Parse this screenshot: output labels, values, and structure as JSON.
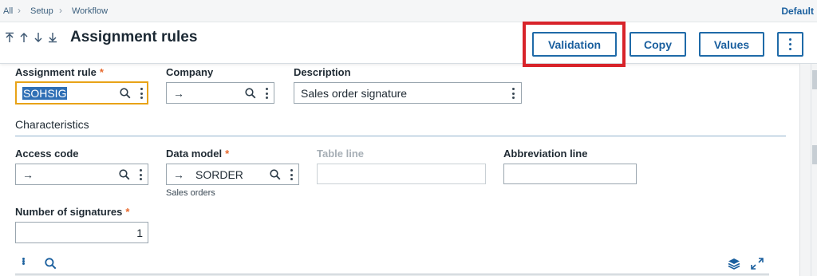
{
  "breadcrumb": {
    "items": [
      "All",
      "Setup",
      "Workflow"
    ],
    "default_link": "Default"
  },
  "header": {
    "title": "Assignment rules",
    "actions": {
      "validation": "Validation",
      "copy": "Copy",
      "values": "Values"
    }
  },
  "form": {
    "assignment_rule": {
      "label": "Assignment rule",
      "required_mark": "*",
      "value": "SOHSIG"
    },
    "company": {
      "label": "Company",
      "arrow": "→",
      "value": ""
    },
    "description": {
      "label": "Description",
      "value": "Sales order signature"
    },
    "characteristics": {
      "title": "Characteristics"
    },
    "access_code": {
      "label": "Access code",
      "arrow": "→",
      "value": ""
    },
    "data_model": {
      "label": "Data model",
      "required_mark": "*",
      "arrow": "→",
      "value": "SORDER",
      "sub_text": "Sales orders"
    },
    "table_line": {
      "label": "Table line",
      "value": ""
    },
    "abbreviation_line": {
      "label": "Abbreviation line",
      "value": ""
    },
    "number_of_signatures": {
      "label": "Number of signatures",
      "required_mark": "*",
      "value": "1"
    }
  },
  "colors": {
    "accent": "#1a5f9e",
    "highlight": "#d8232a",
    "focus": "#e8a317",
    "required": "#e8692d"
  }
}
